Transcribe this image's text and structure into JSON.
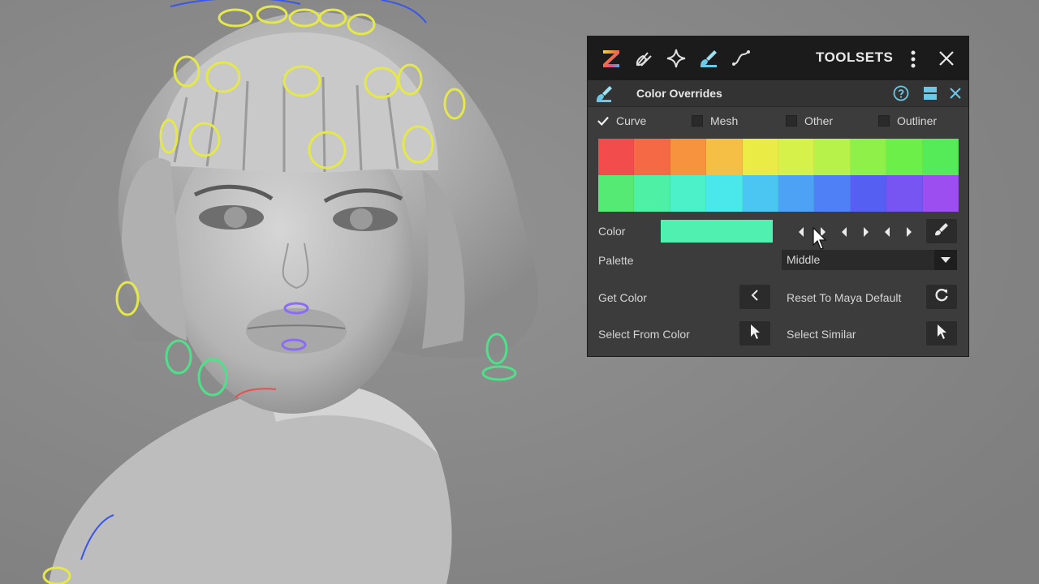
{
  "toolsets": {
    "title": "TOOLSETS",
    "logo_letter": "Z",
    "icons": [
      "z-logo-icon",
      "rocket-brush-icon",
      "sparkle-icon",
      "paint-brush-icon",
      "curve-icon"
    ],
    "panel": {
      "title": "Color Overrides",
      "checkboxes": [
        {
          "label": "Curve",
          "checked": true
        },
        {
          "label": "Mesh",
          "checked": false
        },
        {
          "label": "Other",
          "checked": false
        },
        {
          "label": "Outliner",
          "checked": false
        }
      ],
      "swatches": [
        "#f24c4c",
        "#f56a45",
        "#f7933f",
        "#f5bf45",
        "#eaeb45",
        "#d6f24a",
        "#b6f24a",
        "#8ff04a",
        "#6cf049",
        "#55ea58",
        "#55ea73",
        "#4df0a4",
        "#4cf0c9",
        "#4ae8ea",
        "#4bc6f2",
        "#4da2f5",
        "#4f80f5",
        "#5560f2",
        "#7655f2",
        "#9d4ef0"
      ],
      "color_label": "Color",
      "current_color": "#4ff0b0",
      "palette_label": "Palette",
      "palette_value": "Middle",
      "get_color_label": "Get Color",
      "reset_label": "Reset To Maya Default",
      "select_from_color_label": "Select From Color",
      "select_similar_label": "Select Similar"
    }
  }
}
